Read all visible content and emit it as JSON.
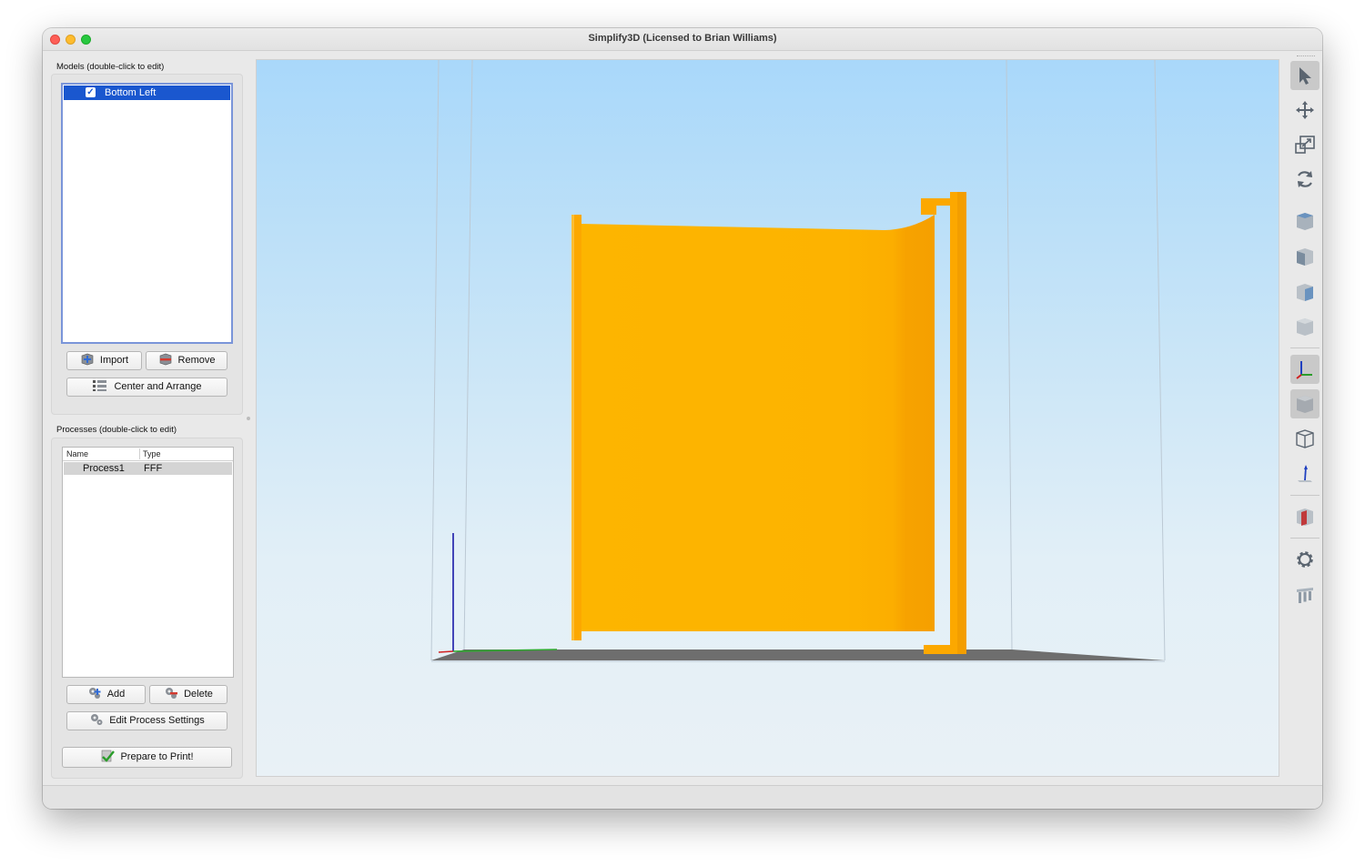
{
  "window": {
    "title": "Simplify3D (Licensed to Brian Williams)"
  },
  "models": {
    "label": "Models (double-click to edit)",
    "items": [
      {
        "name": "Bottom Left",
        "checked": true,
        "selected": true
      }
    ],
    "import_label": "Import",
    "remove_label": "Remove",
    "center_arrange_label": "Center and Arrange"
  },
  "processes": {
    "label": "Processes (double-click to edit)",
    "columns": [
      "Name",
      "Type"
    ],
    "rows": [
      {
        "name": "Process1",
        "type": "FFF"
      }
    ],
    "add_label": "Add",
    "delete_label": "Delete",
    "edit_label": "Edit Process Settings"
  },
  "prepare_label": "Prepare to Print!",
  "toolbar": {
    "tools": [
      "select-pointer-icon",
      "move-icon",
      "scale-icon",
      "rotate-icon",
      "view-cube-icon",
      "view-cube-icon",
      "view-cube-icon",
      "view-cube-icon",
      "axes-icon",
      "solid-view-icon",
      "wireframe-view-icon",
      "normal-vector-icon",
      "section-view-icon",
      "settings-gear-icon",
      "supports-icon"
    ]
  },
  "colors": {
    "model": "#fdb300",
    "model_shade": "#f5a300",
    "selection": "#1a57cf",
    "viewport_top": "#a9d8fa",
    "viewport_bottom": "#e9f1f6"
  }
}
